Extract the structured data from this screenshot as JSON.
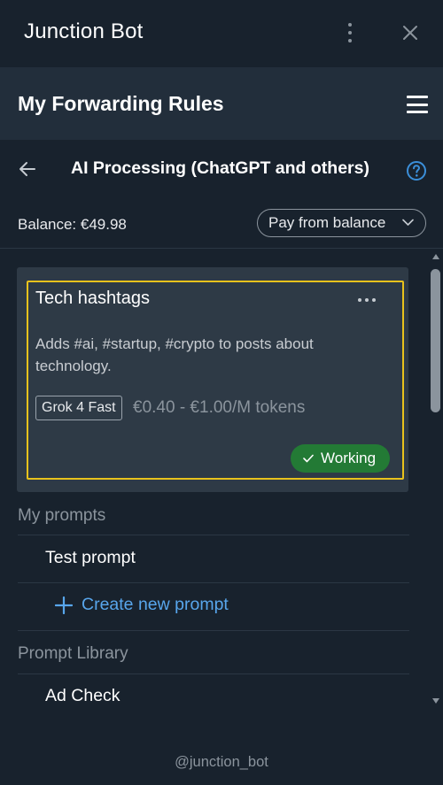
{
  "window": {
    "title": "Junction Bot"
  },
  "header": {
    "title": "My Forwarding Rules"
  },
  "subheader": {
    "title": "AI Processing (ChatGPT and others)"
  },
  "billing": {
    "balance": "Balance: €49.98",
    "payment_method": "Pay from balance"
  },
  "card": {
    "title": "Tech hashtags",
    "description": "Adds #ai, #startup, #crypto to posts about technology.",
    "model": "Grok 4 Fast",
    "price": "€0.40 - €1.00/M tokens",
    "status": "Working"
  },
  "my_prompts": {
    "label": "My prompts",
    "items": [
      "Test prompt"
    ],
    "create_label": "Create new prompt"
  },
  "library": {
    "label": "Prompt Library",
    "items": [
      "Ad Check"
    ]
  },
  "footer": {
    "handle": "@junction_bot"
  },
  "colors": {
    "background": "#18222d",
    "header": "#222e3b",
    "card": "#2e3a46",
    "highlight_border": "#e8c21c",
    "status_green": "#237a35",
    "link_blue": "#58a6ec",
    "help_blue": "#3b8fd9"
  },
  "icons": [
    "more-vert-icon",
    "close-icon",
    "hamburger-menu-icon",
    "back-arrow-icon",
    "help-icon",
    "chevron-down-icon",
    "more-horiz-icon",
    "check-icon",
    "plus-icon"
  ]
}
